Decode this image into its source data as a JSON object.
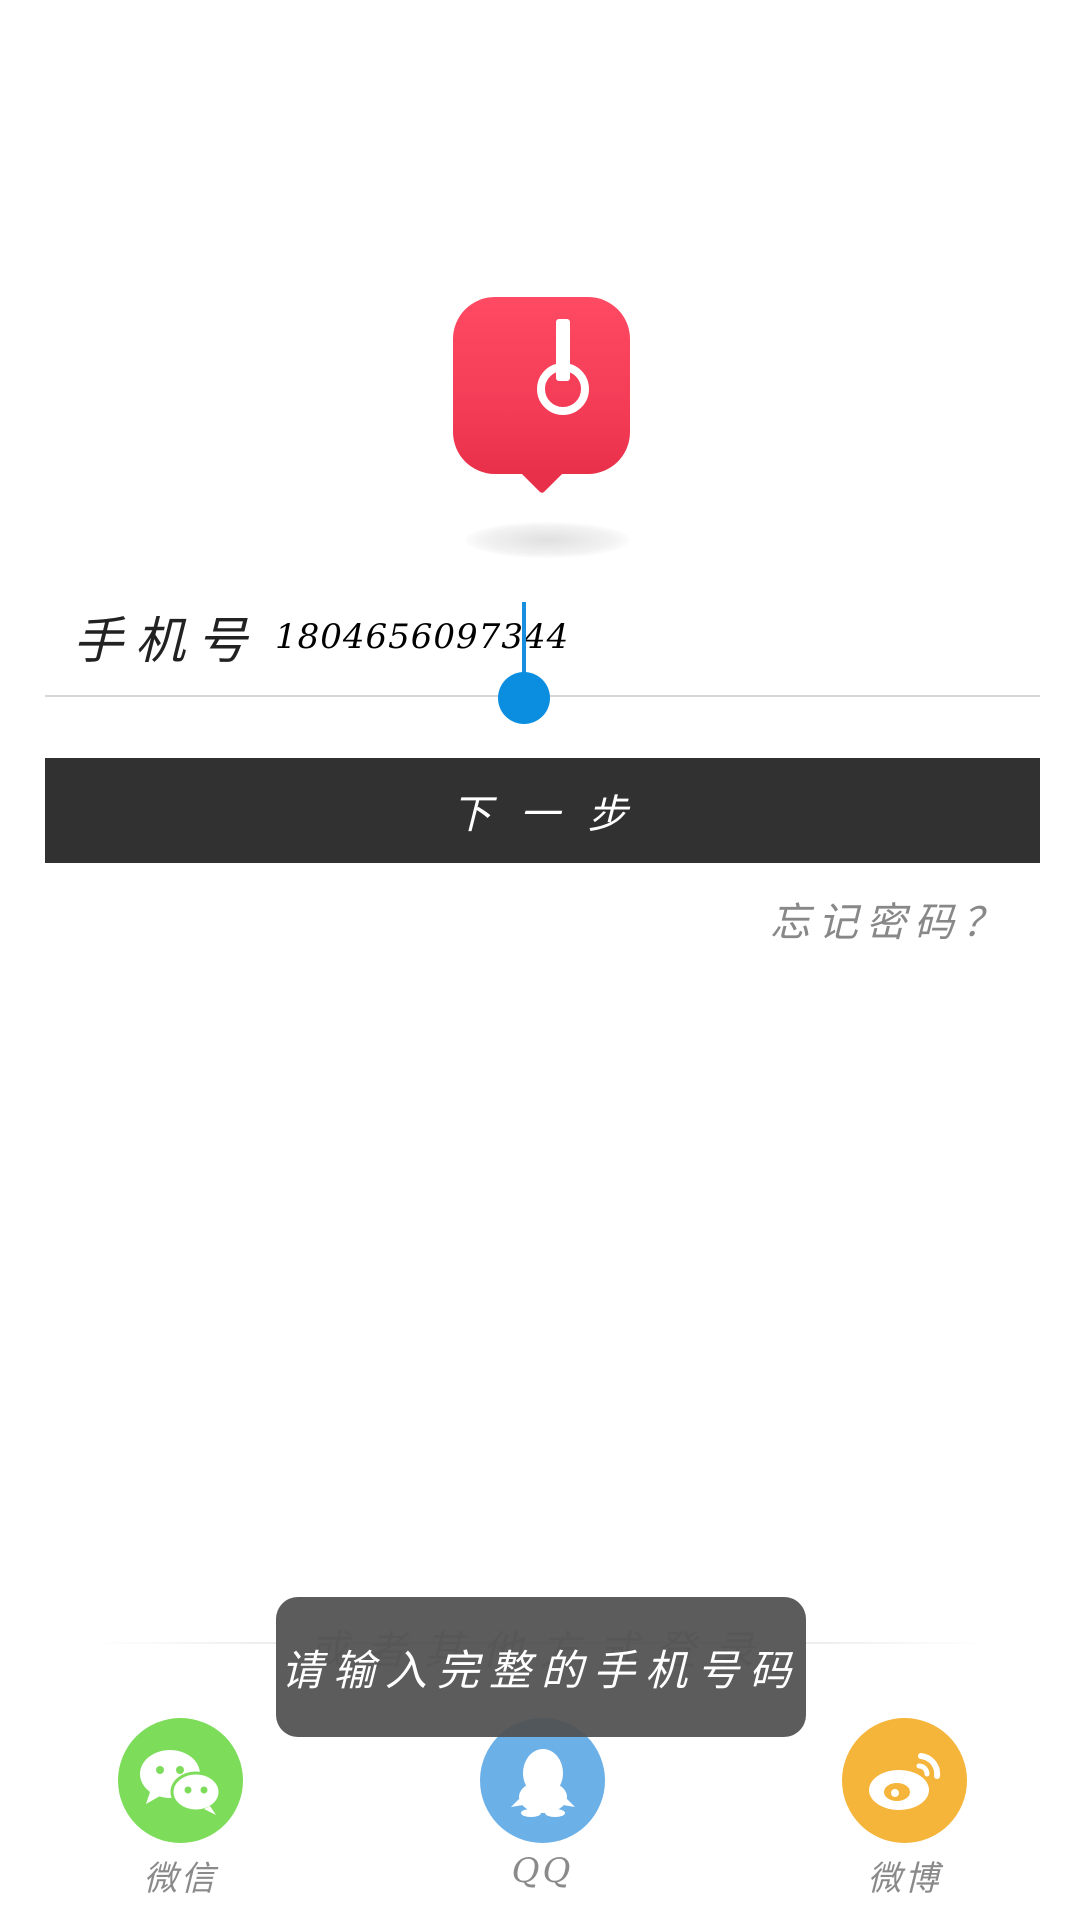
{
  "login": {
    "phone_label": "手机号",
    "phone_value": "1804656097344",
    "next_label": "下一步",
    "forgot_label": "忘记密码？"
  },
  "other_login": {
    "divider_text": "或者其他方式登录",
    "items": [
      {
        "label": "微信",
        "icon": "wechat-icon",
        "color": "#7ddc5a"
      },
      {
        "label": "QQ",
        "icon": "qq-icon",
        "color": "#6cb0e8"
      },
      {
        "label": "微博",
        "icon": "weibo-icon",
        "color": "#f5b53a"
      }
    ]
  },
  "toast": {
    "message": "请输入完整的手机号码"
  },
  "colors": {
    "brand": "#f23a55",
    "button": "#313131",
    "cursor": "#0b8ee0"
  }
}
